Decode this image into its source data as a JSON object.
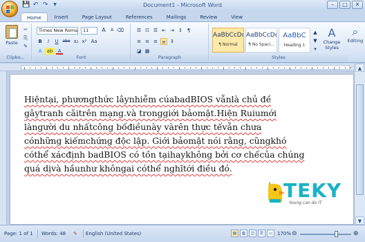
{
  "window": {
    "title": "Document1 - Microsoft Word",
    "controls": [
      "–",
      "□",
      "✕"
    ]
  },
  "quick_access": [
    "💾",
    "↶",
    "↷",
    "▾"
  ],
  "ribbon_tabs": [
    "Home",
    "Insert",
    "Page Layout",
    "References",
    "Mailings",
    "Review",
    "View"
  ],
  "clipboard": {
    "paste_label": "Paste",
    "group_label": "Clipbo..."
  },
  "font": {
    "name": "Times New Roma",
    "size": "11",
    "group_label": "Font",
    "buttons_row1": [
      "A",
      "A",
      "⌫"
    ],
    "buttons_row2": [
      "B",
      "I",
      "U",
      "abe",
      "x₂",
      "x²",
      "Aa"
    ],
    "buttons_row3": [
      "A",
      "ab",
      "A"
    ]
  },
  "paragraph": {
    "group_label": "Paragraph"
  },
  "styles": {
    "group_label": "Styles",
    "items": [
      {
        "preview": "AaBbCcDc",
        "name": "¶ Normal"
      },
      {
        "preview": "AaBbCcDc",
        "name": "¶ No Spaci..."
      },
      {
        "preview": "AaBbC",
        "name": "Heading 1"
      }
    ],
    "change_styles": "Change Styles",
    "editing": "Editing"
  },
  "document": {
    "lines": [
      "Hiệntại, phươngthức lâynhiễm cúabadBIOS vẫnlà chủ đề",
      "gâytranh cãitrên mạng.và tronggiới bảomật.Hiện Ruiumới",
      "làngười du nhấtcông bốđiềunày vàrên thực tếvẫn chưa",
      "cónhững kiếmchứng độc lập. Giới bảomật nói rằng, cũngkhó",
      "cóthể xácđịnh badBIOS có tồn tạihaykhông bởi cơ chếcủa chúng",
      "quá dịvà hầunhư khôngai cóthể nghĩtới điều đó."
    ]
  },
  "watermark": {
    "brand": "TEKY",
    "tagline": "Young can do IT"
  },
  "status_bar": {
    "page": "Page: 1 of 1",
    "words": "Words: 48",
    "language": "English (United States)",
    "zoom": "170%",
    "zoom_level": 0.7,
    "zoom_out": "⊖",
    "zoom_in": "⊕"
  }
}
